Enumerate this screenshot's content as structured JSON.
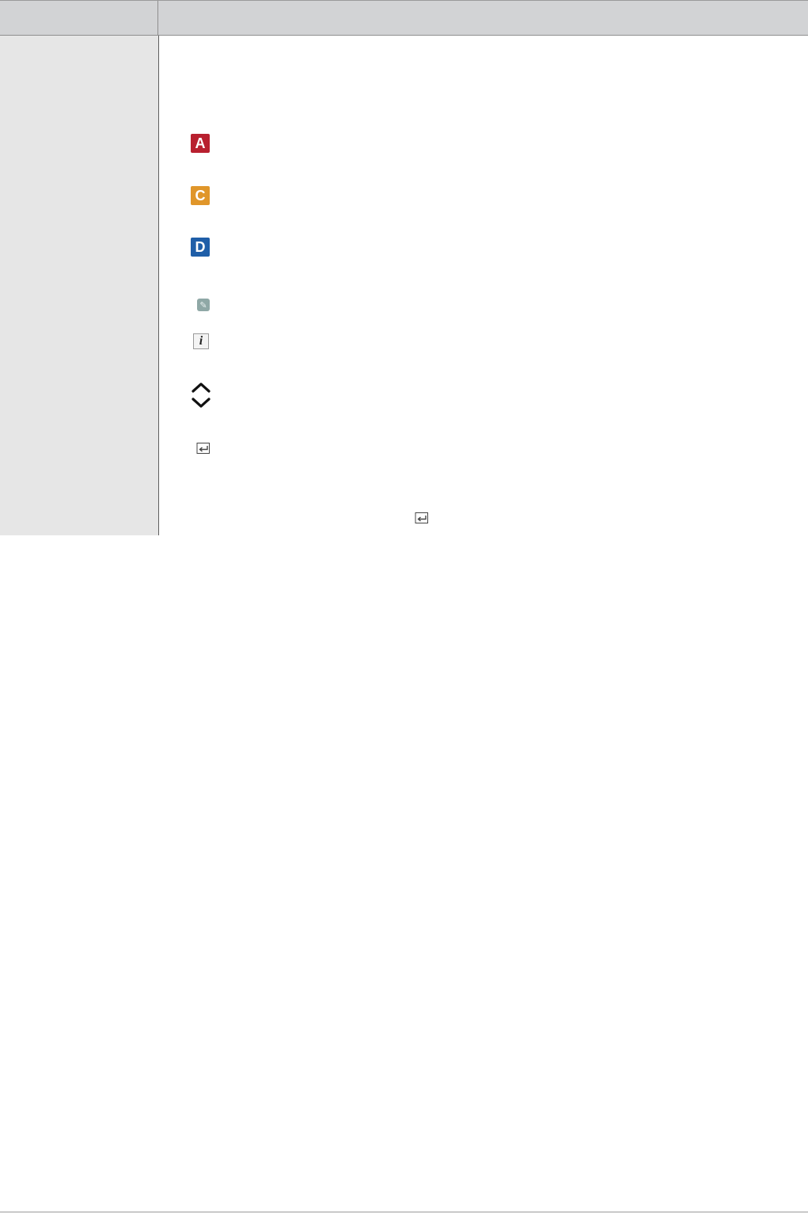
{
  "icons": {
    "red_key": {
      "letter": "A",
      "color": "#b8202f"
    },
    "yellow_key": {
      "letter": "C",
      "color": "#e0962a"
    },
    "blue_key": {
      "letter": "D",
      "color": "#1f5ea8"
    },
    "pencil": {
      "glyph": "✎"
    },
    "info": {
      "glyph": "i"
    }
  }
}
